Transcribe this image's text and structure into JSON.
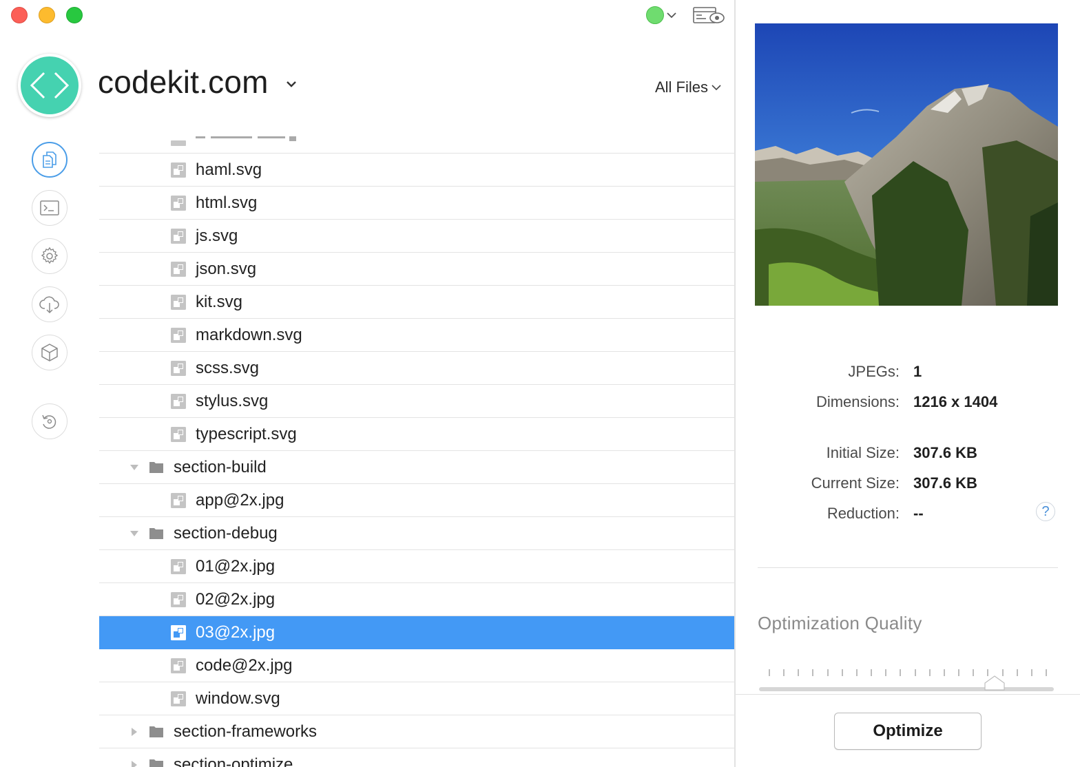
{
  "window": {
    "controls": [
      "close",
      "minimize",
      "zoom"
    ]
  },
  "toolbar": {
    "status_color": "#6fdc6f",
    "status_icon": "green-status-dot",
    "preview_icon": "browser-preview-eye-icon"
  },
  "project": {
    "name": "codekit.com",
    "logo_color": "#45d2b0",
    "logo_icon": "code-brackets-icon",
    "filter_label": "All Files"
  },
  "nav": {
    "items": [
      {
        "name": "files",
        "icon": "files-icon",
        "active": true
      },
      {
        "name": "log",
        "icon": "terminal-icon",
        "active": false
      },
      {
        "name": "settings",
        "icon": "gear-icon",
        "active": false
      },
      {
        "name": "cloud",
        "icon": "cloud-download-icon",
        "active": false
      },
      {
        "name": "packages",
        "icon": "cube-icon",
        "active": false
      },
      {
        "name": "refresh",
        "icon": "refresh-icon",
        "active": false
      }
    ],
    "accent_color": "#4a9de8"
  },
  "files": {
    "rows": [
      {
        "type": "file",
        "label": "haml.svg"
      },
      {
        "type": "file",
        "label": "html.svg"
      },
      {
        "type": "file",
        "label": "js.svg"
      },
      {
        "type": "file",
        "label": "json.svg"
      },
      {
        "type": "file",
        "label": "kit.svg"
      },
      {
        "type": "file",
        "label": "markdown.svg"
      },
      {
        "type": "file",
        "label": "scss.svg"
      },
      {
        "type": "file",
        "label": "stylus.svg"
      },
      {
        "type": "file",
        "label": "typescript.svg"
      },
      {
        "type": "folder",
        "label": "section-build",
        "expanded": true
      },
      {
        "type": "file",
        "label": "app@2x.jpg"
      },
      {
        "type": "folder",
        "label": "section-debug",
        "expanded": true
      },
      {
        "type": "file",
        "label": "01@2x.jpg"
      },
      {
        "type": "file",
        "label": "02@2x.jpg"
      },
      {
        "type": "file",
        "label": "03@2x.jpg",
        "selected": true
      },
      {
        "type": "file",
        "label": "code@2x.jpg"
      },
      {
        "type": "file",
        "label": "window.svg"
      },
      {
        "type": "folder",
        "label": "section-frameworks",
        "expanded": false
      },
      {
        "type": "folder",
        "label": "section-optimize",
        "expanded": false
      }
    ],
    "selection_color": "#4399f5"
  },
  "inspector": {
    "info": [
      {
        "key": "JPEGs:",
        "value": "1"
      },
      {
        "key": "Dimensions:",
        "value": "1216 x 1404"
      },
      {
        "key": "Initial Size:",
        "value": "307.6 KB"
      },
      {
        "key": "Current Size:",
        "value": "307.6 KB"
      },
      {
        "key": "Reduction:",
        "value": "--"
      }
    ],
    "help_label": "?",
    "quality_title": "Optimization Quality",
    "quality_level": 0.8,
    "optimize_label": "Optimize"
  }
}
